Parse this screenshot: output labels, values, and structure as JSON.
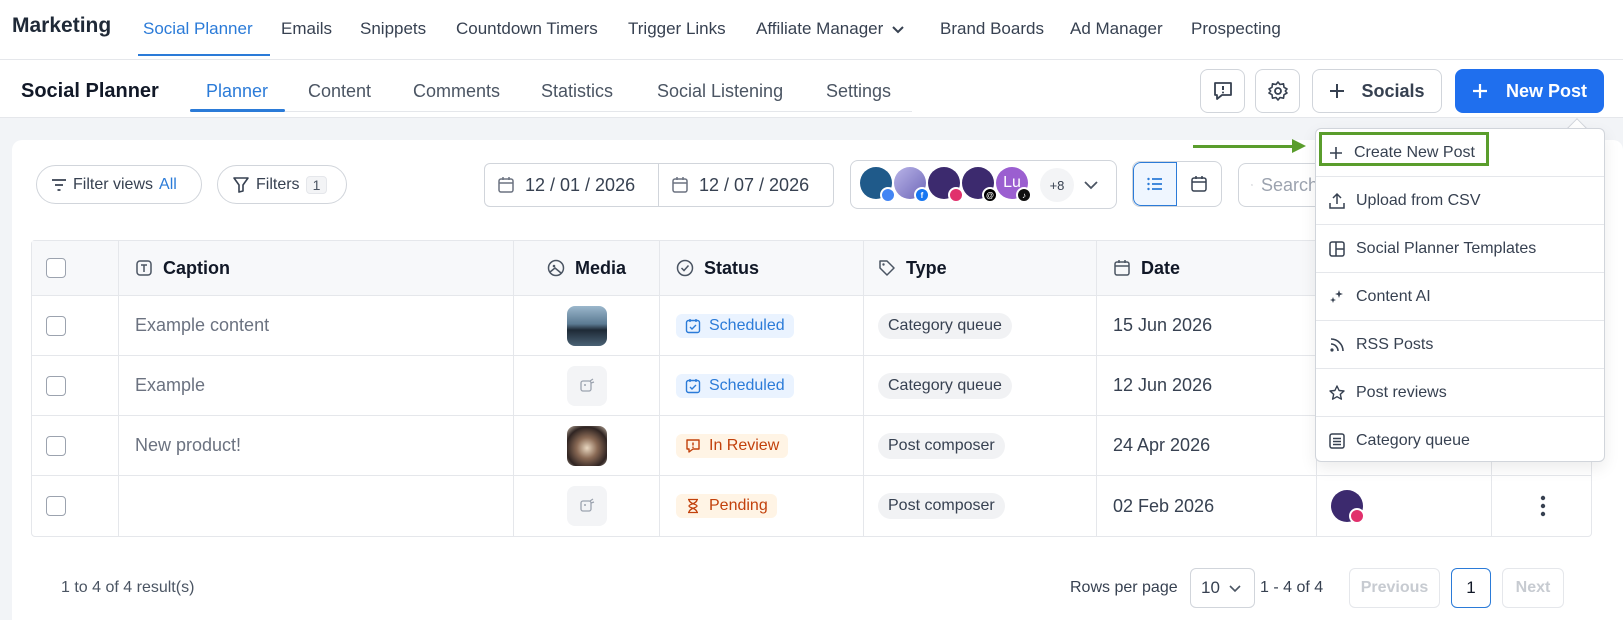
{
  "topnav": {
    "brand": "Marketing",
    "items": [
      {
        "label": "Social Planner"
      },
      {
        "label": "Emails"
      },
      {
        "label": "Snippets"
      },
      {
        "label": "Countdown Timers"
      },
      {
        "label": "Trigger Links"
      },
      {
        "label": "Affiliate Manager"
      },
      {
        "label": "Brand Boards"
      },
      {
        "label": "Ad Manager"
      },
      {
        "label": "Prospecting"
      }
    ]
  },
  "subnav": {
    "title": "Social Planner",
    "tabs": [
      {
        "label": "Planner"
      },
      {
        "label": "Content"
      },
      {
        "label": "Comments"
      },
      {
        "label": "Statistics"
      },
      {
        "label": "Social Listening"
      },
      {
        "label": "Settings"
      }
    ],
    "socials_label": "Socials",
    "new_post_label": "New Post"
  },
  "toolbar": {
    "filter_views_label": "Filter views",
    "filter_views_value": "All",
    "filters_label": "Filters",
    "filters_count": "1",
    "date_start": "12 / 01 / 2026",
    "date_end": "12 / 07 / 2026",
    "avatar_initials": "Lu",
    "more_accounts": "+8",
    "search_placeholder": "Search"
  },
  "table": {
    "headers": {
      "caption": "Caption",
      "media": "Media",
      "status": "Status",
      "type": "Type",
      "date": "Date"
    },
    "rows": [
      {
        "caption": "Example content",
        "status": "Scheduled",
        "type": "Category queue",
        "date": "15 Jun 2026"
      },
      {
        "caption": "Example",
        "status": "Scheduled",
        "type": "Category queue",
        "date": "12 Jun 2026"
      },
      {
        "caption": "New product!",
        "status": "In Review",
        "type": "Post composer",
        "date": "24 Apr 2026"
      },
      {
        "caption": "",
        "status": "Pending",
        "type": "Post composer",
        "date": "02 Feb 2026"
      }
    ]
  },
  "footer": {
    "results": "1 to 4 of 4 result(s)",
    "rows_per_page_label": "Rows per page",
    "rows_per_page_value": "10",
    "range": "1 - 4 of 4",
    "previous": "Previous",
    "page": "1",
    "next": "Next"
  },
  "dropdown": {
    "items": [
      {
        "label": "Create New Post",
        "icon": "plus-icon"
      },
      {
        "label": "Upload from CSV",
        "icon": "upload-icon"
      },
      {
        "label": "Social Planner Templates",
        "icon": "template-icon"
      },
      {
        "label": "Content AI",
        "icon": "sparkle-icon"
      },
      {
        "label": "RSS Posts",
        "icon": "rss-icon"
      },
      {
        "label": "Post reviews",
        "icon": "star-icon"
      },
      {
        "label": "Category queue",
        "icon": "list-icon"
      }
    ]
  },
  "colors": {
    "accent": "#2b7bd8",
    "primary_button": "#1f6fee",
    "highlight": "#5a9d2c"
  }
}
